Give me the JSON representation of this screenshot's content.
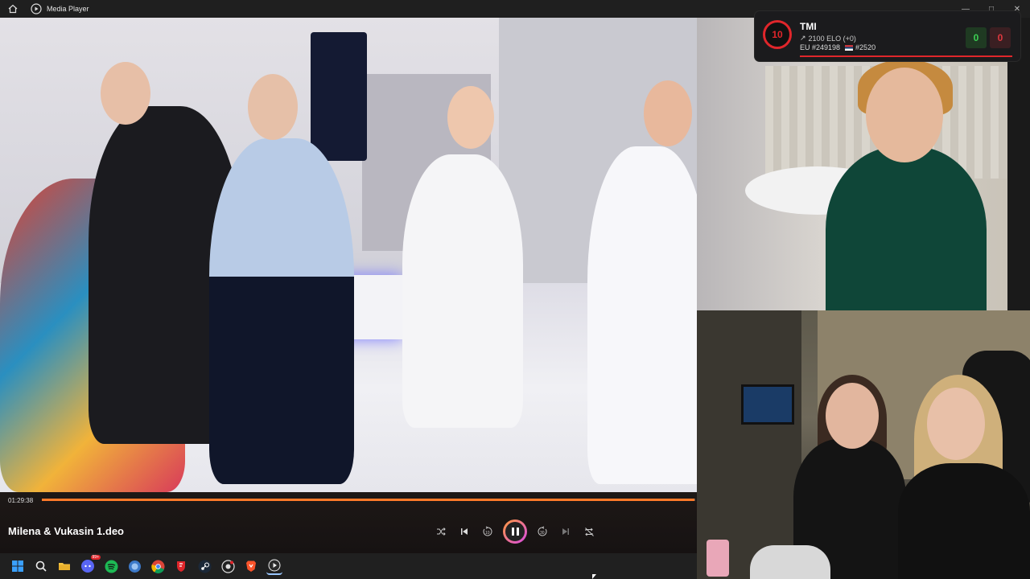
{
  "window": {
    "title": "Media Player"
  },
  "player": {
    "current_time": "01:29:38",
    "progress_fraction": 0.999,
    "file_name": "Milena & Vukasin 1.deo",
    "controls": {
      "shuffle": "shuffle-icon",
      "previous": "previous-icon",
      "rewind": "rewind-10-icon",
      "play_pause": "pause-icon",
      "forward": "forward-30-icon",
      "next": "next-icon",
      "repeat": "repeat-off-icon"
    },
    "accent_color": "#ff7a2a"
  },
  "elo_overlay": {
    "level": "10",
    "name": "TMI",
    "elo_text": "2100 ELO (+0)",
    "region_rank": "EU #249198",
    "country_rank": "#2520",
    "wins": "0",
    "losses": "0",
    "level_color": "#e0262b"
  },
  "taskbar": {
    "icons": [
      "windows-start-icon",
      "search-icon",
      "file-explorer-icon",
      "discord-icon",
      "spotify-icon",
      "ffz-icon",
      "chrome-icon",
      "faceit-icon",
      "steam-icon",
      "github-icon",
      "brave-icon",
      "media-player-icon"
    ],
    "discord_badge": "99+"
  }
}
